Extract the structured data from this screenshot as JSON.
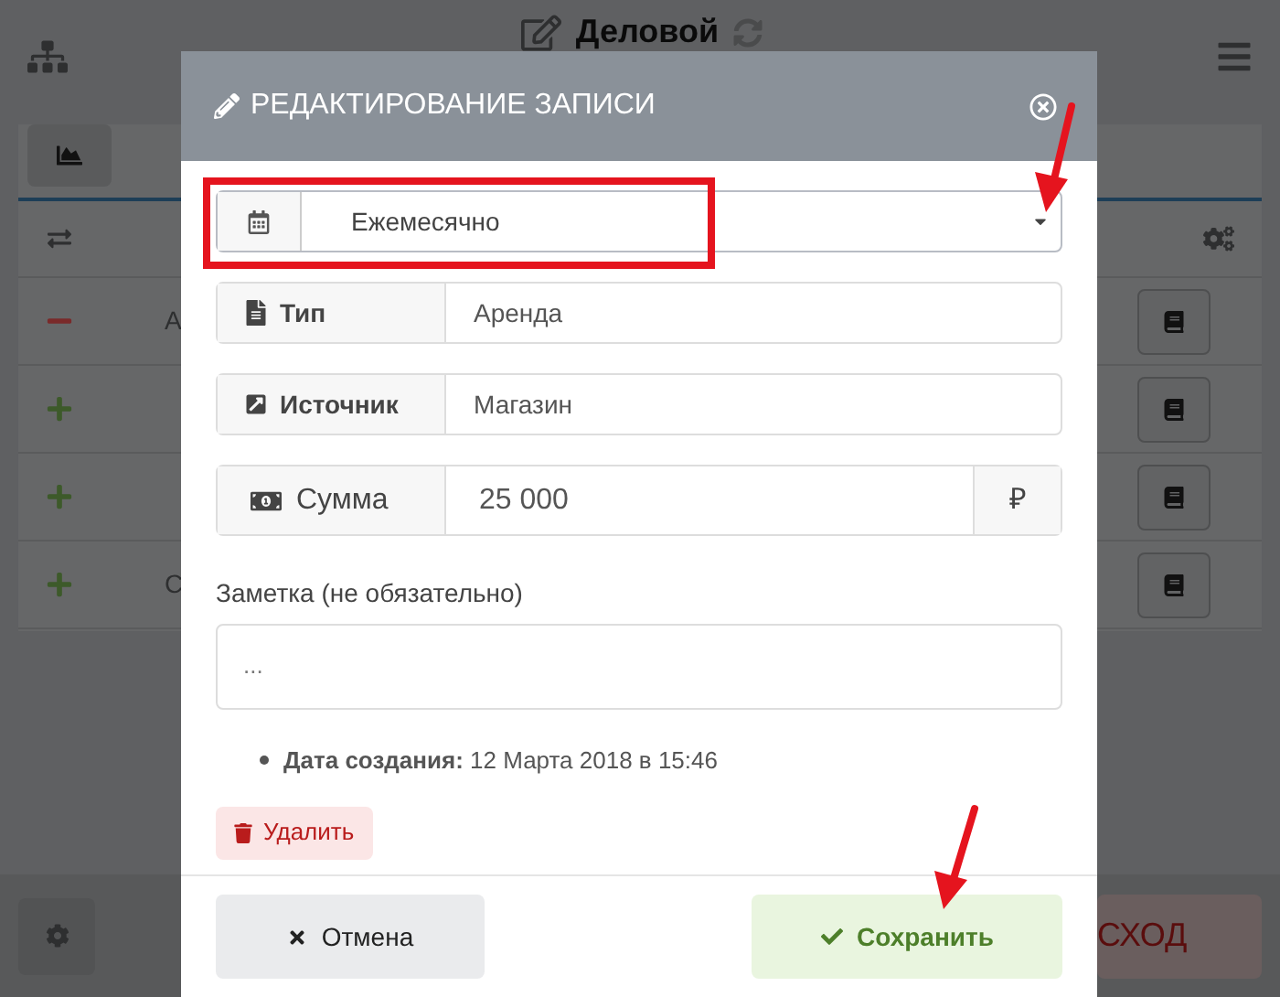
{
  "app": {
    "title": "Деловой",
    "rows": [
      {
        "kind": "expense",
        "text": "А"
      },
      {
        "kind": "income"
      },
      {
        "kind": "income"
      },
      {
        "kind": "income",
        "text": "С"
      }
    ],
    "expense_button": "СХОД"
  },
  "modal": {
    "title": "РЕДАКТИРОВАНИЕ ЗАПИСИ",
    "period": "Ежемесячно",
    "fields": [
      {
        "label": "Тип",
        "value": "Аренда"
      },
      {
        "label": "Источник",
        "value": "Магазин"
      }
    ],
    "amount": {
      "label": "Сумма",
      "value": "25 000",
      "currency": "₽"
    },
    "note": {
      "label": "Заметка (не обязательно)",
      "placeholder": "..."
    },
    "created": {
      "label": "Дата создания:",
      "value": "12 Марта 2018 в 15:46"
    },
    "delete_button": "Удалить",
    "cancel_button": "Отмена",
    "save_button": "Сохранить"
  }
}
